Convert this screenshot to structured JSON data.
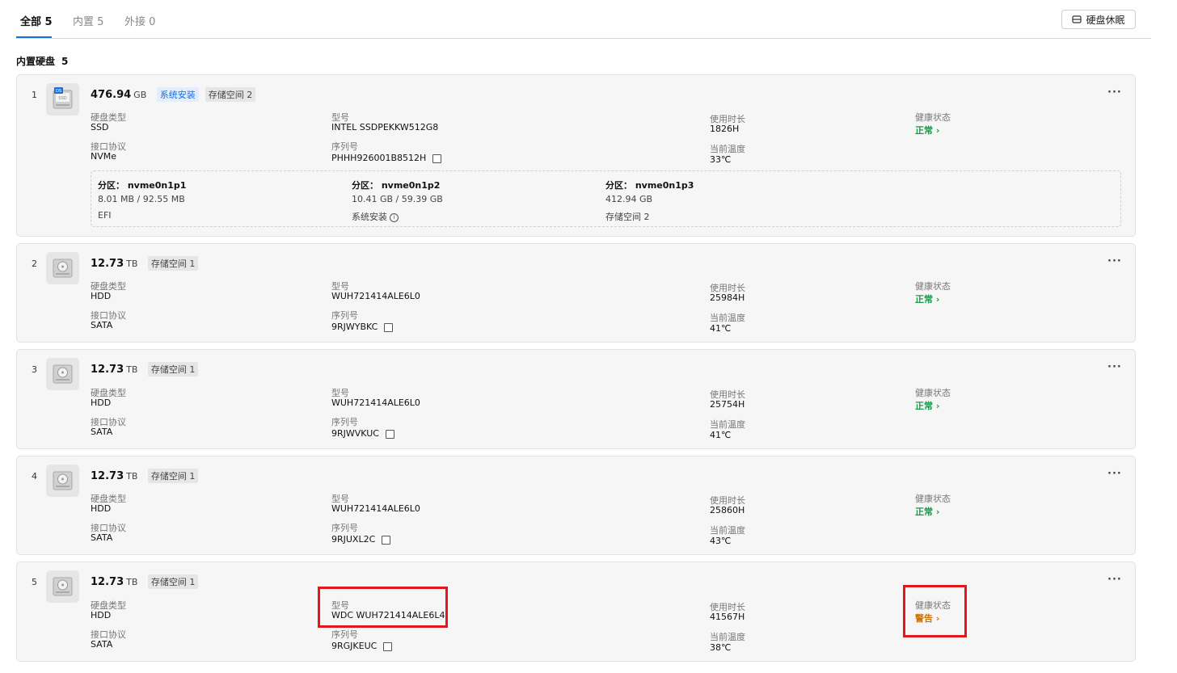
{
  "tabs": [
    {
      "label": "全部 5"
    },
    {
      "label": "内置 5"
    },
    {
      "label": "外接 0"
    }
  ],
  "sleep_button": {
    "label": "硬盘休眠",
    "icon": "sleep-icon"
  },
  "section": {
    "title": "内置硬盘",
    "count": "5"
  },
  "labels": {
    "disk_type": "硬盘类型",
    "interface": "接口协议",
    "model": "型号",
    "serial": "序列号",
    "uptime": "使用时长",
    "temperature": "当前温度",
    "health": "健康状态",
    "more": "···"
  },
  "disks": [
    {
      "index": "1",
      "capacity": "476.94",
      "unit": "GB",
      "tags": [
        "系统安装",
        "存储空间 2"
      ],
      "icon_badge": "OS",
      "icon_label": "SSD",
      "type": "SSD",
      "interface": "NVMe",
      "model": "INTEL SSDPEKKW512G8",
      "serial": "PHHH926001B8512H",
      "uptime": "1826H",
      "temperature": "33℃",
      "health": "正常",
      "health_status": "normal",
      "partitions": [
        {
          "name": "分区： nvme0n1p1",
          "size": "8.01 MB / 92.55 MB",
          "usage": "EFI"
        },
        {
          "name": "分区： nvme0n1p2",
          "size": "10.41 GB / 59.39 GB",
          "usage": "系统安装"
        },
        {
          "name": "分区： nvme0n1p3",
          "size": "412.94 GB",
          "usage": "存储空间 2"
        }
      ]
    },
    {
      "index": "2",
      "capacity": "12.73",
      "unit": "TB",
      "tags": [
        "存储空间 1"
      ],
      "type": "HDD",
      "interface": "SATA",
      "model": "WUH721414ALE6L0",
      "serial": "9RJWYBKC",
      "uptime": "25984H",
      "temperature": "41℃",
      "health": "正常",
      "health_status": "normal"
    },
    {
      "index": "3",
      "capacity": "12.73",
      "unit": "TB",
      "tags": [
        "存储空间 1"
      ],
      "type": "HDD",
      "interface": "SATA",
      "model": "WUH721414ALE6L0",
      "serial": "9RJWVKUC",
      "uptime": "25754H",
      "temperature": "41℃",
      "health": "正常",
      "health_status": "normal"
    },
    {
      "index": "4",
      "capacity": "12.73",
      "unit": "TB",
      "tags": [
        "存储空间 1"
      ],
      "type": "HDD",
      "interface": "SATA",
      "model": "WUH721414ALE6L0",
      "serial": "9RJUXL2C",
      "uptime": "25860H",
      "temperature": "43℃",
      "health": "正常",
      "health_status": "normal"
    },
    {
      "index": "5",
      "capacity": "12.73",
      "unit": "TB",
      "tags": [
        "存储空间 1"
      ],
      "type": "HDD",
      "interface": "SATA",
      "model": "WDC WUH721414ALE6L4",
      "serial": "9RGJKEUC",
      "uptime": "41567H",
      "temperature": "38℃",
      "health": "警告",
      "health_status": "warning"
    }
  ],
  "colors": {
    "accent": "#1a6fe0",
    "ok": "#1a9a4a",
    "warn": "#d27200",
    "highlight": "#e0191c"
  }
}
